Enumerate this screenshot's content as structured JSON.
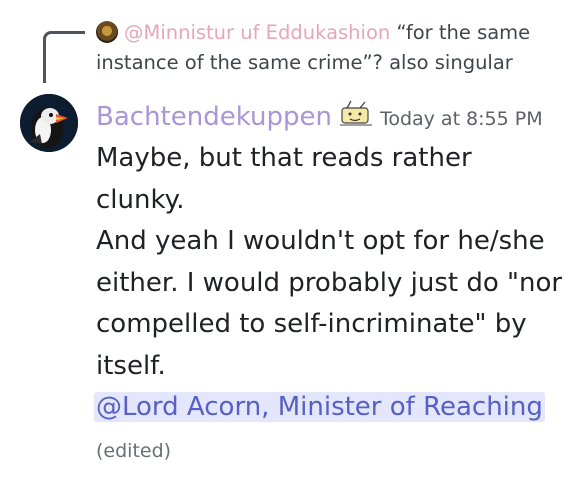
{
  "reply": {
    "mention": "@Minnistur uf Eddukashion",
    "text": "“for the same instance of the same crime”? also singular"
  },
  "message": {
    "username": "Bachtendekuppen",
    "timestamp": "Today at 8:55 PM",
    "paragraph1": "Maybe, but that reads rather clunky.",
    "paragraph2": "And yeah I wouldn't opt for he/she either. I would probably just do \"nor compelled to self-incriminate\" by itself.",
    "mention": "@Lord Acorn, Minister of Reaching",
    "edited": "(edited)"
  },
  "icons": {
    "reply_avatar": "user-avatar-icon",
    "avatar": "puffin-avatar-icon",
    "badge": "cartoon-emoji-icon"
  },
  "colors": {
    "username": "#a995d8",
    "reply_mention": "#e6a6b8",
    "mention_text": "#5760c4",
    "mention_bg": "#e4e6fb"
  }
}
